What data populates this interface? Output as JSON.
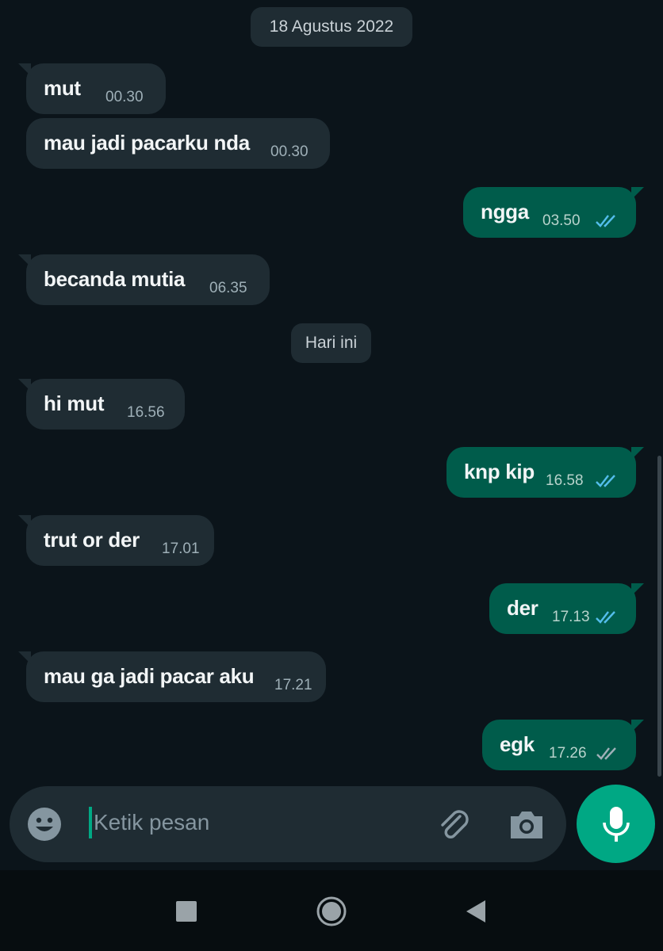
{
  "chat": {
    "date_labels": [
      "18 Agustus 2022",
      "Hari ini"
    ],
    "messages": [
      {
        "direction": "in",
        "text": "mut",
        "time": "00.30"
      },
      {
        "direction": "in",
        "text": "mau jadi pacarku nda",
        "time": "00.30"
      },
      {
        "direction": "out",
        "text": "ngga",
        "time": "03.50",
        "status": "read"
      },
      {
        "direction": "in",
        "text": "becanda mutia",
        "time": "06.35"
      },
      {
        "direction": "in",
        "text": "hi mut",
        "time": "16.56"
      },
      {
        "direction": "out",
        "text": "knp kip",
        "time": "16.58",
        "status": "read"
      },
      {
        "direction": "in",
        "text": "trut or der",
        "time": "17.01"
      },
      {
        "direction": "out",
        "text": "der",
        "time": "17.13",
        "status": "read"
      },
      {
        "direction": "in",
        "text": "mau ga jadi pacar aku",
        "time": "17.21"
      },
      {
        "direction": "out",
        "text": "egk",
        "time": "17.26",
        "status": "delivered"
      }
    ]
  },
  "composer": {
    "placeholder": "Ketik pesan",
    "icons": [
      "emoji-icon",
      "paperclip-icon",
      "camera-icon",
      "microphone-icon"
    ]
  },
  "navbar": {
    "icons": [
      "recents-square-icon",
      "home-circle-icon",
      "back-triangle-icon"
    ]
  },
  "colors": {
    "background": "#0b141a",
    "incoming_bubble": "#1f2c33",
    "outgoing_bubble": "#005c4b",
    "accent": "#00a884",
    "read_tick": "#53bdeb",
    "delivered_tick": "#9fb0b8"
  }
}
